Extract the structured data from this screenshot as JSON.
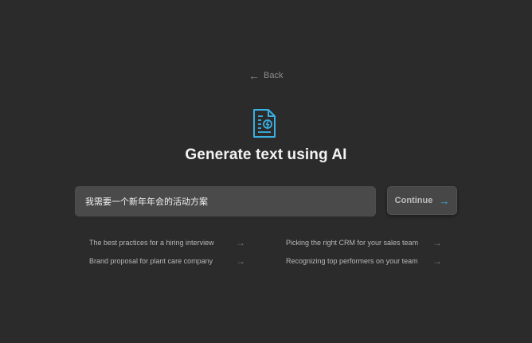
{
  "back": {
    "label": "Back",
    "icon": "arrow-left-icon"
  },
  "header": {
    "icon": "ai-document-icon",
    "title": "Generate text using AI"
  },
  "prompt": {
    "value": "我需要一个新年年会的活动方案",
    "placeholder": ""
  },
  "continue": {
    "label": "Continue",
    "icon": "arrow-right-icon"
  },
  "suggestions": [
    {
      "label": "The best practices for a hiring interview",
      "icon": "arrow-right-icon"
    },
    {
      "label": "Picking the right CRM for your sales team",
      "icon": "arrow-right-icon"
    },
    {
      "label": "Brand proposal for plant care company",
      "icon": "arrow-right-icon"
    },
    {
      "label": "Recognizing top performers on your team",
      "icon": "arrow-right-icon"
    }
  ],
  "colors": {
    "background": "#2b2b2b",
    "accent": "#3ab0e3",
    "input_bg": "#4a4a4a",
    "button_bg": "#474747"
  }
}
